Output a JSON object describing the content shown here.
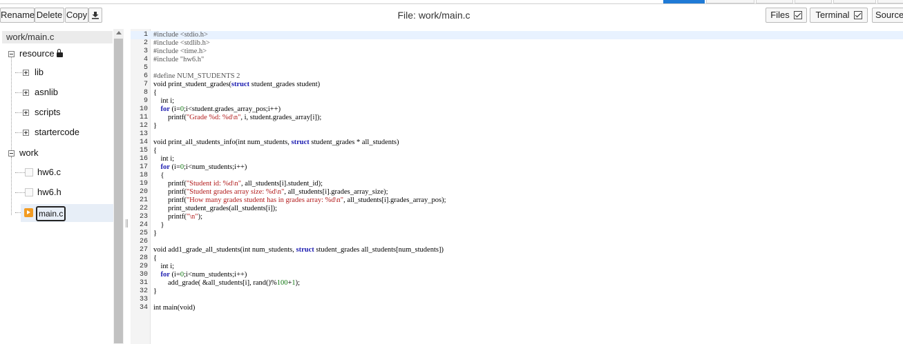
{
  "toolbar": {
    "rename_label": "Rename",
    "delete_label": "Delete",
    "copy_label": "Copy",
    "download_icon": "download-icon",
    "file_title": "File: work/main.c",
    "files_label": "Files",
    "terminal_label": "Terminal",
    "source_label": "Source"
  },
  "tree": {
    "path": "work/main.c",
    "resource_label": "resource",
    "lib_label": "lib",
    "asnlib_label": "asnlib",
    "scripts_label": "scripts",
    "startercode_label": "startercode",
    "work_label": "work",
    "hw6c_label": "hw6.c",
    "hw6h_label": "hw6.h",
    "mainc_label": "main.c"
  },
  "editor": {
    "active_line": 1,
    "lines": [
      [
        {
          "t": "#include <stdio.h>",
          "c": "pre"
        }
      ],
      [
        {
          "t": "#include <stdlib.h>",
          "c": "pre"
        }
      ],
      [
        {
          "t": "#include <time.h>",
          "c": "pre"
        }
      ],
      [
        {
          "t": "#include \"hw6.h\"",
          "c": "pre"
        }
      ],
      [],
      [
        {
          "t": "#define NUM_STUDENTS 2",
          "c": "pre"
        }
      ],
      [
        {
          "t": "void print_student_grades("
        },
        {
          "t": "struct",
          "c": "kw"
        },
        {
          "t": " student_grades student)"
        }
      ],
      [
        {
          "t": "{"
        }
      ],
      [
        {
          "t": "    int i;"
        }
      ],
      [
        {
          "t": "    "
        },
        {
          "t": "for",
          "c": "kw"
        },
        {
          "t": " (i="
        },
        {
          "t": "0",
          "c": "num"
        },
        {
          "t": ";i<student.grades_array_pos;i++)"
        }
      ],
      [
        {
          "t": "        printf("
        },
        {
          "t": "\"Grade %d: %d\\n\"",
          "c": "str"
        },
        {
          "t": ", i, student.grades_array[i]);"
        }
      ],
      [
        {
          "t": "}"
        }
      ],
      [],
      [
        {
          "t": "void print_all_students_info(int num_students, "
        },
        {
          "t": "struct",
          "c": "kw"
        },
        {
          "t": " student_grades * all_students)"
        }
      ],
      [
        {
          "t": "{"
        }
      ],
      [
        {
          "t": "    int i;"
        }
      ],
      [
        {
          "t": "    "
        },
        {
          "t": "for",
          "c": "kw"
        },
        {
          "t": " (i="
        },
        {
          "t": "0",
          "c": "num"
        },
        {
          "t": ";i<num_students;i++)"
        }
      ],
      [
        {
          "t": "    {"
        }
      ],
      [
        {
          "t": "        printf("
        },
        {
          "t": "\"Student id: %d\\n\"",
          "c": "str"
        },
        {
          "t": ", all_students[i].student_id);"
        }
      ],
      [
        {
          "t": "        printf("
        },
        {
          "t": "\"Student grades array size: %d\\n\"",
          "c": "str"
        },
        {
          "t": ", all_students[i].grades_array_size);"
        }
      ],
      [
        {
          "t": "        printf("
        },
        {
          "t": "\"How many grades student has in grades array: %d\\n\"",
          "c": "str"
        },
        {
          "t": ", all_students[i].grades_array_pos);"
        }
      ],
      [
        {
          "t": "        print_student_grades(all_students[i]);"
        }
      ],
      [
        {
          "t": "        printf("
        },
        {
          "t": "\"\\n\"",
          "c": "str"
        },
        {
          "t": ");"
        }
      ],
      [
        {
          "t": "    }"
        }
      ],
      [
        {
          "t": "}"
        }
      ],
      [],
      [
        {
          "t": "void add1_grade_all_students(int num_students, "
        },
        {
          "t": "struct",
          "c": "kw"
        },
        {
          "t": " student_grades all_students[num_students])"
        }
      ],
      [
        {
          "t": "{"
        }
      ],
      [
        {
          "t": "    int i;"
        }
      ],
      [
        {
          "t": "    "
        },
        {
          "t": "for",
          "c": "kw"
        },
        {
          "t": " (i="
        },
        {
          "t": "0",
          "c": "num"
        },
        {
          "t": ";i<num_students;i++)"
        }
      ],
      [
        {
          "t": "        add_grade( &all_students[i], rand()%"
        },
        {
          "t": "100",
          "c": "num"
        },
        {
          "t": "+"
        },
        {
          "t": "1",
          "c": "num"
        },
        {
          "t": ");"
        }
      ],
      [
        {
          "t": "}"
        }
      ],
      [],
      [
        {
          "t": "int main(void)"
        }
      ]
    ]
  }
}
